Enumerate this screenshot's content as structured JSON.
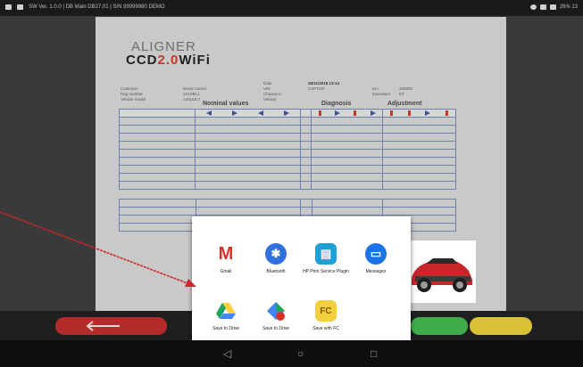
{
  "statusbar": {
    "left_text": "SW Ver. 1.0.0  |  DB Main DB27.01  |  S/N 99999980 DEMO",
    "right_text": "26% 13"
  },
  "report": {
    "brand_top": "ALIGNER",
    "brand_main_a": "CCD",
    "brand_main_b": "2.0",
    "brand_main_c": "WiFi",
    "meta_left": [
      "Customer",
      "Reg number",
      "Vehicle model"
    ],
    "meta_left_vals": [
      "David Carvel",
      "1K12BL1",
      "AZGaJL7"
    ],
    "meta_mid": [
      "Date",
      "VIN",
      "Chassis n.",
      "Vehicle"
    ],
    "meta_mid_vals": [
      "26/11/2019 13:14",
      "",
      "",
      "CAPTUR"
    ],
    "meta_right": [
      "Km",
      "Executant"
    ],
    "meta_right_vals": [
      "330000",
      "DT"
    ],
    "section_nominal": "Nominal values",
    "section_diagnosis": "Diagnosis",
    "section_adjustment": "Adjustment"
  },
  "share_sheet": {
    "apps": [
      {
        "label": "Gmail",
        "icon": "gmail-icon",
        "glyph": "M",
        "color": "#ffffff",
        "fg": "#d93025"
      },
      {
        "label": "Bluetooth",
        "icon": "bluetooth-icon",
        "glyph": "✱",
        "color": "#2f6fe0",
        "fg": "#ffffff"
      },
      {
        "label": "HP Print Service Plugin",
        "icon": "hp-print-icon",
        "glyph": "▤",
        "color": "#1ba0d8",
        "fg": "#ffffff"
      },
      {
        "label": "Messages",
        "icon": "messages-icon",
        "glyph": "▭",
        "color": "#1a73e8",
        "fg": "#ffffff"
      },
      {
        "label": "Save to Drive",
        "icon": "drive-icon",
        "glyph": "▲",
        "color": "#ffffff",
        "fg": "#1aa260"
      },
      {
        "label": "Save to Drive",
        "icon": "drive-alt-icon",
        "glyph": "◆",
        "color": "#ffffff",
        "fg": "#34a853"
      },
      {
        "label": "Save with FC",
        "icon": "fc-icon",
        "glyph": "FC",
        "color": "#f4d03f",
        "fg": "#7a5a00"
      }
    ]
  },
  "navbar": {
    "back": "◁",
    "home": "○",
    "recents": "□"
  },
  "colors": {
    "accent_red": "#c0392b",
    "accent_blue": "#1a2f6e",
    "pill_green": "#3fae49",
    "pill_yellow": "#d9c235",
    "pill_red": "#b52a2a"
  }
}
